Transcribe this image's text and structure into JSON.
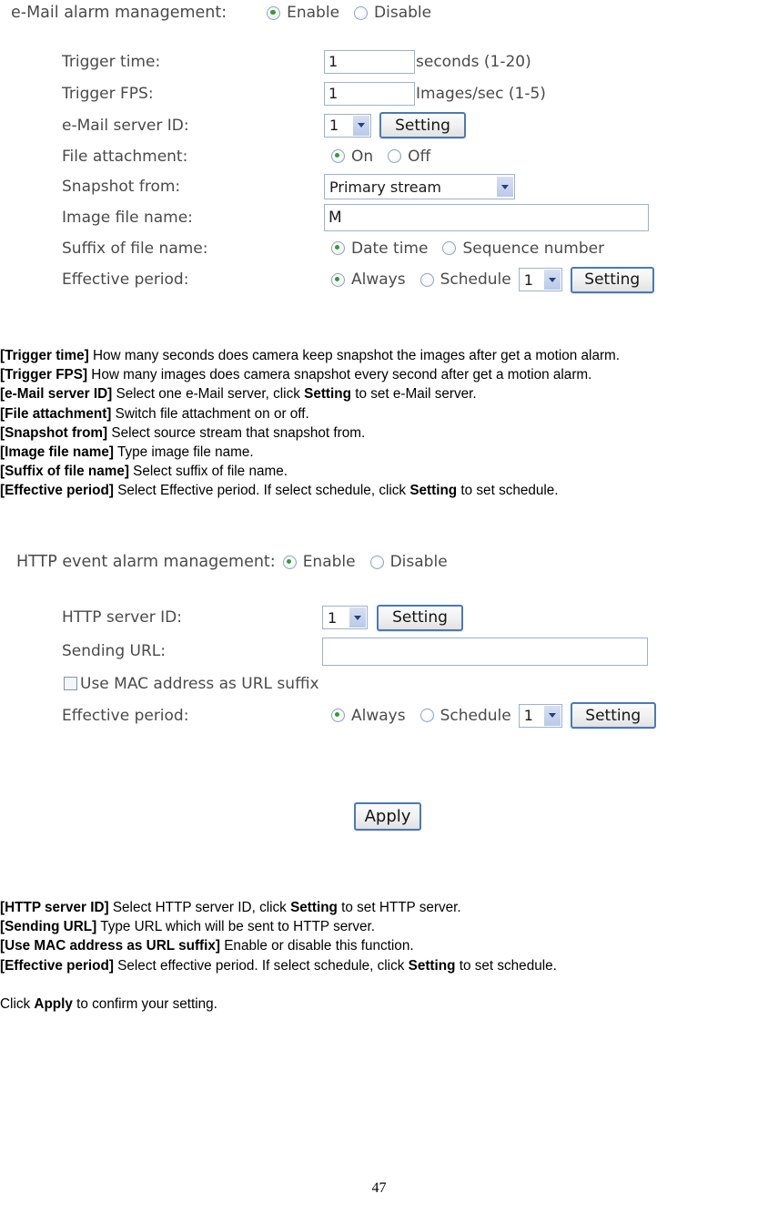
{
  "page": {
    "number": "47"
  },
  "email_section": {
    "header_label": "e-Mail alarm management:",
    "header_options": [
      {
        "label": "Enable",
        "checked": true
      },
      {
        "label": "Disable",
        "checked": false
      }
    ],
    "rows": {
      "trigger_time": {
        "label": "Trigger time:",
        "value": "1",
        "unit": "seconds (1-20)"
      },
      "trigger_fps": {
        "label": "Trigger FPS:",
        "value": "1",
        "unit": "Images/sec (1-5)"
      },
      "email_server_id": {
        "label": "e-Mail server ID:",
        "value": "1",
        "button": "Setting"
      },
      "file_attachment": {
        "label": "File attachment:",
        "options": [
          {
            "label": "On",
            "checked": true
          },
          {
            "label": "Off",
            "checked": false
          }
        ]
      },
      "snapshot_from": {
        "label": "Snapshot from:",
        "value": "Primary stream"
      },
      "image_file_name": {
        "label": "Image file name:",
        "value": "M"
      },
      "suffix_of_file_name": {
        "label": "Suffix of file name:",
        "options": [
          {
            "label": "Date time",
            "checked": true
          },
          {
            "label": "Sequence number",
            "checked": false
          }
        ]
      },
      "effective_period": {
        "label": "Effective period:",
        "options": [
          {
            "label": "Always",
            "checked": true
          },
          {
            "label": "Schedule",
            "checked": false
          }
        ],
        "schedule_value": "1",
        "button": "Setting"
      }
    }
  },
  "email_help": [
    {
      "term": "[Trigger time]",
      "text": " How many seconds does camera keep snapshot the images after get a motion alarm."
    },
    {
      "term": "[Trigger FPS]",
      "text": " How many images does camera snapshot every second after get a motion alarm."
    },
    {
      "term": "[e-Mail server ID]",
      "text": " Select one e-Mail server, click ",
      "bold": "Setting",
      "tail": " to set e-Mail server."
    },
    {
      "term": "[File attachment]",
      "text": " Switch file attachment on or off."
    },
    {
      "term": "[Snapshot from]",
      "text": " Select source stream that snapshot from."
    },
    {
      "term": "[Image file name]",
      "text": " Type image file name."
    },
    {
      "term": "[Suffix of file name]",
      "text": " Select suffix of file name."
    },
    {
      "term": "[Effective period]",
      "text": " Select Effective period. If select schedule, click ",
      "bold": "Setting",
      "tail": " to set schedule."
    }
  ],
  "http_section": {
    "header_label": "HTTP event alarm management:",
    "header_options": [
      {
        "label": "Enable",
        "checked": true
      },
      {
        "label": "Disable",
        "checked": false
      }
    ],
    "rows": {
      "http_server_id": {
        "label": "HTTP server ID:",
        "value": "1",
        "button": "Setting"
      },
      "sending_url": {
        "label": "Sending URL:",
        "value": ""
      },
      "use_mac_suffix": {
        "label": "Use MAC address as URL suffix",
        "checked": false
      },
      "effective_period": {
        "label": "Effective period:",
        "options": [
          {
            "label": "Always",
            "checked": true
          },
          {
            "label": "Schedule",
            "checked": false
          }
        ],
        "schedule_value": "1",
        "button": "Setting"
      }
    },
    "apply_button": "Apply"
  },
  "http_help": [
    {
      "term": "[HTTP server ID]",
      "text": " Select HTTP server ID, click ",
      "bold": "Setting",
      "tail": " to set HTTP server."
    },
    {
      "term": "[Sending URL]",
      "text": " Type URL which will be sent to HTTP server."
    },
    {
      "term": "[Use MAC address as URL suffix]",
      "text": " Enable or disable this function."
    },
    {
      "term": "[Effective period]",
      "text": " Select effective period. If select schedule, click ",
      "bold": "Setting",
      "tail": " to set schedule."
    }
  ],
  "closing_note": {
    "prefix": "Click ",
    "bold": "Apply",
    "suffix": " to confirm your setting."
  }
}
